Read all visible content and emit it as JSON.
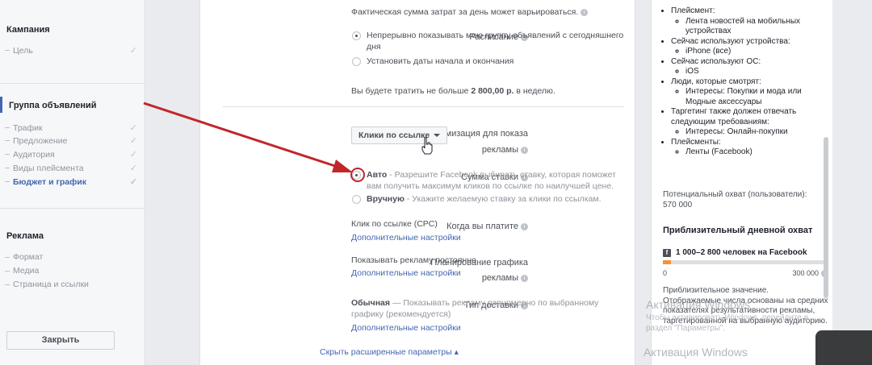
{
  "sidebar": {
    "campaign_title": "Кампания",
    "campaign_items": [
      {
        "label": "Цель"
      }
    ],
    "adset_title": "Группа объявлений",
    "adset_items": [
      {
        "label": "Трафик"
      },
      {
        "label": "Предложение"
      },
      {
        "label": "Аудитория"
      },
      {
        "label": "Виды плейсмента"
      },
      {
        "label": "Бюджет и график"
      }
    ],
    "ad_title": "Реклама",
    "ad_items": [
      {
        "label": "Формат"
      },
      {
        "label": "Медиа"
      },
      {
        "label": "Страница и ссылки"
      }
    ],
    "close_label": "Закрыть"
  },
  "main": {
    "cost_note": "Фактическая сумма затрат за день может варьироваться.",
    "schedule_label": "Расписание",
    "schedule_option1_line1": "Непрерывно показывать мою группу объявлений с сегодняшнего",
    "schedule_option1_line2": "дня",
    "schedule_option2": "Установить даты начала и окончания",
    "spend_prefix": "Вы будете тратить не больше ",
    "spend_amount": "2 800,00 р.",
    "spend_suffix": " в неделю.",
    "opt_label_line1": "Оптимизация для показа",
    "opt_label_line2": "рекламы",
    "opt_value": "Клики по ссылке",
    "bid_label": "Сумма ставки",
    "bid_auto_title": "Авто",
    "bid_auto_desc_line1": " - Разрешите Facebook выбирать ставку, которая поможет",
    "bid_auto_desc_line2": "вам получить максимум кликов по ссылке по наилучшей цене.",
    "bid_manual_title": "Вручную",
    "bid_manual_desc": " - Укажите желаемую ставку за клики по ссылкам.",
    "pay_label": "Когда вы платите",
    "pay_value": "Клик по ссылке (CPC)",
    "pay_link": "Дополнительные настройки",
    "sched_label_line1": "Планирование графика",
    "sched_label_line2": "рекламы",
    "sched_value": "Показывать рекламу постоянно",
    "sched_link": "Дополнительные настройки",
    "delivery_label": "Тип доставки",
    "delivery_title": "Обычная",
    "delivery_desc_line1": " — Показывать рекламу равномерно по выбранному",
    "delivery_desc_line2": "графику (рекомендуется)",
    "delivery_link": "Дополнительные настройки",
    "hide_advanced": "Скрыть расширенные параметры ▴"
  },
  "right_panel": {
    "items": [
      {
        "text": "Плейсмент:",
        "sub": [
          "Лента новостей на мобильных устройствах"
        ]
      },
      {
        "text": "Сейчас используют устройства:",
        "sub": [
          "iPhone (все)"
        ]
      },
      {
        "text": "Сейчас используют ОС:",
        "sub": [
          "iOS"
        ]
      },
      {
        "text": "Люди, которые смотрят:",
        "sub": [
          "Интересы: Покупки и мода или Модные аксессуары"
        ]
      },
      {
        "text": "Таргетинг также должен отвечать следующим требованиям:",
        "sub": [
          "Интересы: Онлайн-покупки"
        ]
      },
      {
        "text": "Плейсменты:",
        "sub": [
          "Ленты (Facebook)"
        ]
      }
    ],
    "potential_reach_label": "Потенциальный охват (пользователи):",
    "potential_reach_value": "570 000",
    "daily_reach_title": "Приблизительный дневной охват",
    "fb_reach": "1 000–2 800 человек на Facebook",
    "fb_icon": "f",
    "reach_fraction": 0.05,
    "bar_min": "0",
    "bar_max": "300 000",
    "note": "Приблизительное значение. Отображаемые числа основаны на средних показателях результативности рекламы, таргетированной на выбранную аудиторию."
  },
  "watermark": {
    "title": "Активация Windows",
    "sub1": "Чтобы активировать Windows, перейдите в",
    "sub2": "раздел \"Параметры\"."
  },
  "colors": {
    "accent": "#4267b2",
    "arrow": "#c0262a",
    "bar_fill": "#f7923a"
  }
}
